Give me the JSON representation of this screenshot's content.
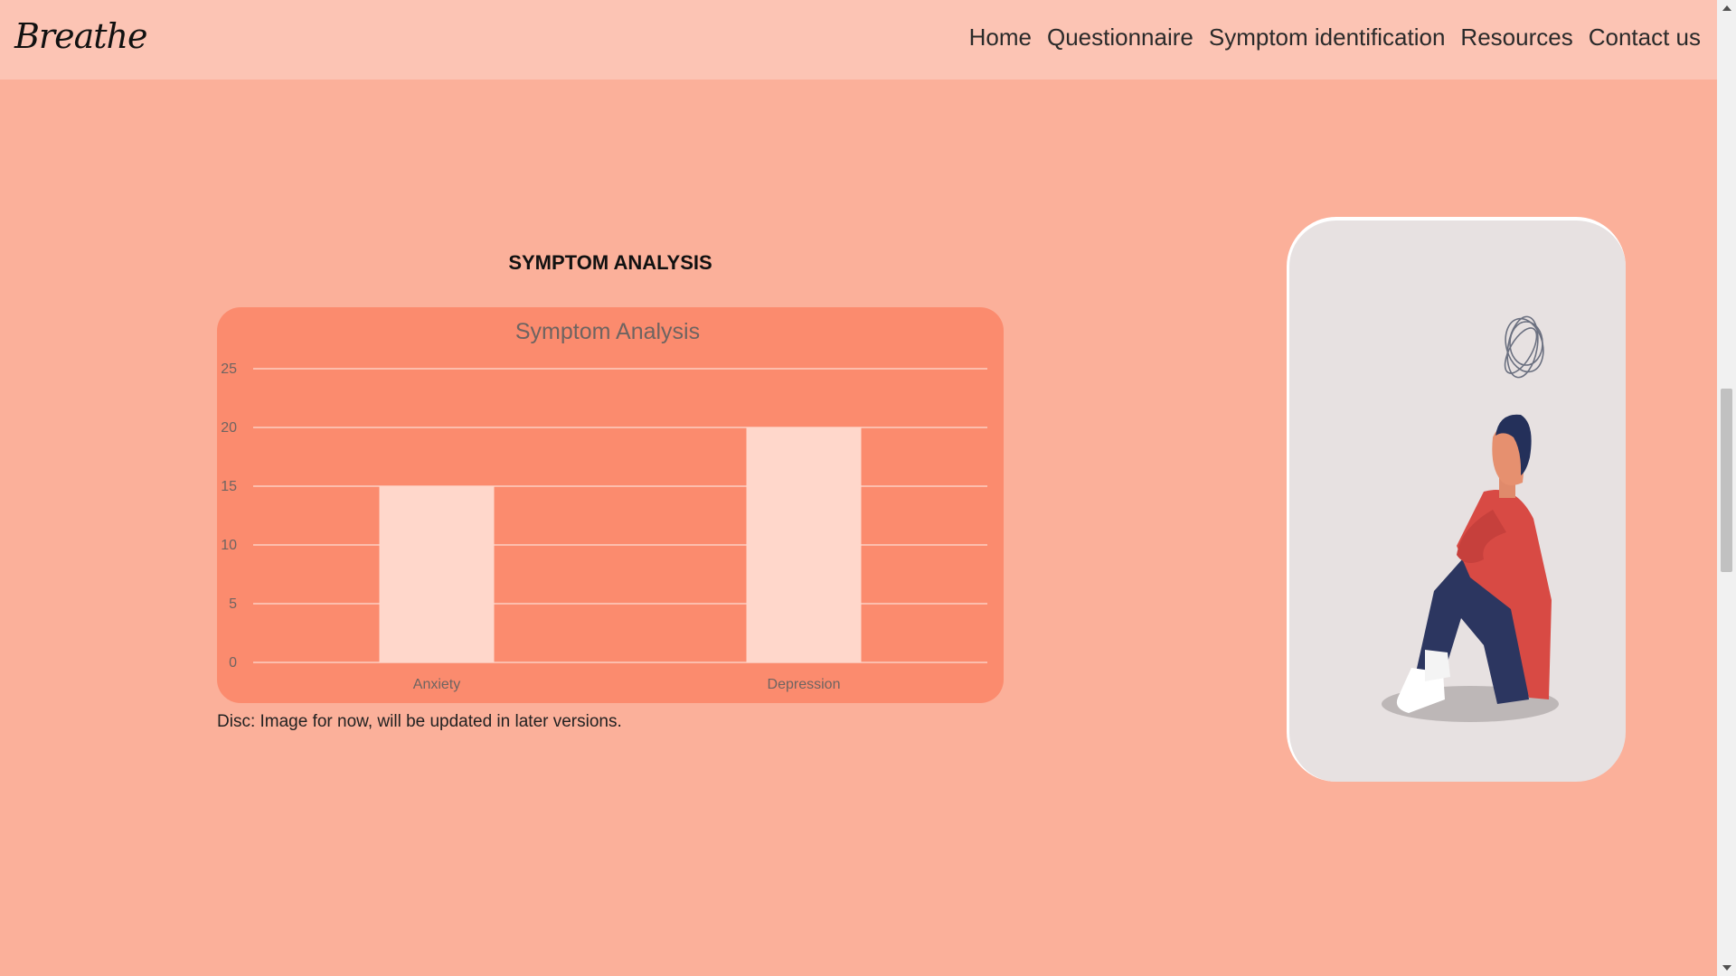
{
  "nav": {
    "logo": "Breathe",
    "links": [
      {
        "label": "Home"
      },
      {
        "label": "Questionnaire"
      },
      {
        "label": "Symptom identification"
      },
      {
        "label": "Resources"
      },
      {
        "label": "Contact us"
      }
    ]
  },
  "main": {
    "section_title": "SYMPTOM ANALYSIS",
    "disclaimer": "Disc: Image for now, will be updated in later versions."
  },
  "chart_data": {
    "type": "bar",
    "title": "Symptom Analysis",
    "categories": [
      "Anxiety",
      "Depression"
    ],
    "values": [
      15,
      20
    ],
    "ylim": [
      0,
      25
    ],
    "yticks": [
      0,
      5,
      10,
      15,
      20,
      25
    ],
    "grid": true,
    "colors": {
      "background": "#fb8b6e",
      "bar": "#ffd7cb",
      "grid": "#fcd0c2",
      "text": "#6e6461"
    }
  },
  "colors": {
    "page_bg": "#fbb09a",
    "nav_bg": "#fcc4b4",
    "illustration_bg": "#e7e1e1"
  },
  "illustration": {
    "icon": "person-sitting-sad-illustration"
  }
}
